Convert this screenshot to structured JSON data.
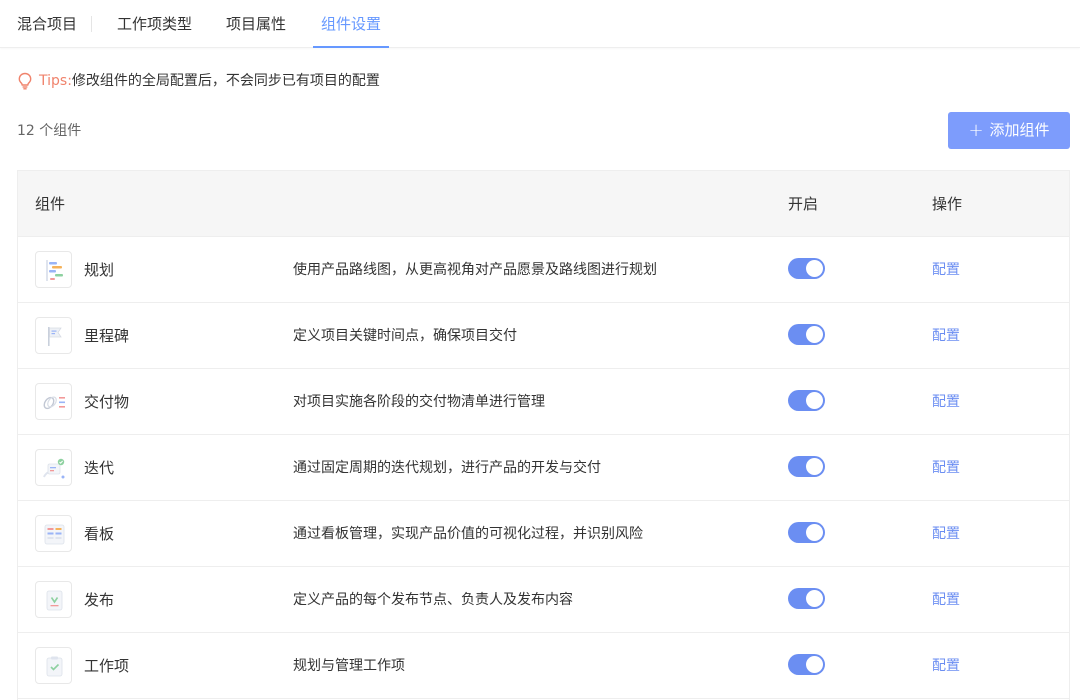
{
  "tabs": [
    {
      "label": "混合项目"
    },
    {
      "label": "工作项类型"
    },
    {
      "label": "项目属性"
    },
    {
      "label": "组件设置",
      "active": true
    }
  ],
  "tips": {
    "label": "Tips:",
    "text": "修改组件的全局配置后，不会同步已有项目的配置",
    "icon": "lightbulb-icon"
  },
  "summary": {
    "count_text": "12 个组件"
  },
  "toolbar": {
    "add_label": "添加组件",
    "add_icon": "plus-icon"
  },
  "table": {
    "headers": {
      "name": "组件",
      "enable": "开启",
      "operation": "操作"
    },
    "rows": [
      {
        "name": "规划",
        "desc": "使用产品路线图，从更高视角对产品愿景及路线图进行规划",
        "enabled": true,
        "action": "配置",
        "icon": "roadmap-icon"
      },
      {
        "name": "里程碑",
        "desc": "定义项目关键时间点，确保项目交付",
        "enabled": true,
        "action": "配置",
        "icon": "milestone-flag-icon"
      },
      {
        "name": "交付物",
        "desc": "对项目实施各阶段的交付物清单进行管理",
        "enabled": true,
        "action": "配置",
        "icon": "deliverable-icon"
      },
      {
        "name": "迭代",
        "desc": "通过固定周期的迭代规划，进行产品的开发与交付",
        "enabled": true,
        "action": "配置",
        "icon": "iteration-icon"
      },
      {
        "name": "看板",
        "desc": "通过看板管理，实现产品价值的可视化过程，并识别风险",
        "enabled": true,
        "action": "配置",
        "icon": "kanban-icon"
      },
      {
        "name": "发布",
        "desc": "定义产品的每个发布节点、负责人及发布内容",
        "enabled": true,
        "action": "配置",
        "icon": "release-icon"
      },
      {
        "name": "工作项",
        "desc": "规划与管理工作项",
        "enabled": true,
        "action": "配置",
        "icon": "work-item-icon"
      }
    ]
  },
  "colors": {
    "accent": "#6698ff",
    "toggle_on": "#6b8ef2",
    "button_bg": "#7d9cfc",
    "tips": "#f0836c",
    "header_bg": "#f6f6f6"
  }
}
